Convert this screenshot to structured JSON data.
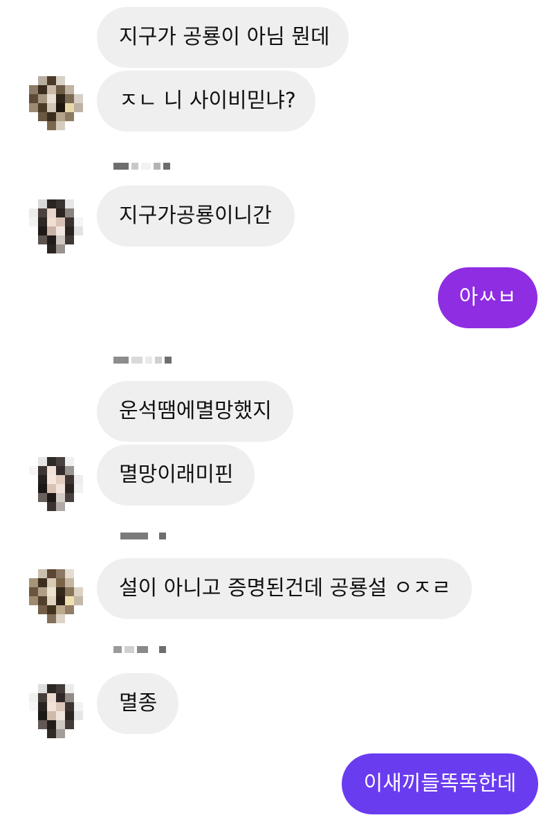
{
  "chat": {
    "messages": [
      {
        "direction": "in",
        "text": "지구가 공룡이 아님 뭔데"
      },
      {
        "direction": "in",
        "text": "ㅈㄴ 니 사이비믿냐?"
      },
      {
        "direction": "in",
        "text": "지구가공룡이니간"
      },
      {
        "direction": "out",
        "text": "아ㅆㅂ"
      },
      {
        "direction": "in",
        "text": "운석땜에멸망했지"
      },
      {
        "direction": "in",
        "text": "멸망이래미핀"
      },
      {
        "direction": "in",
        "text": "설이 아니고 증명된건데 공룡설 ㅇㅈㄹ"
      },
      {
        "direction": "in",
        "text": "멸종"
      },
      {
        "direction": "out",
        "text": "이새끼들똑똑한데"
      }
    ]
  },
  "colors": {
    "incoming_bubble": "#efefef",
    "incoming_text": "#111111",
    "outgoing_bubble_1": "#8e2de2",
    "outgoing_bubble_2": "#6a3cf0",
    "outgoing_text": "#ffffff"
  },
  "avatars": [
    {
      "name": "avatar-user-1",
      "icon": "pixelated-profile-photo"
    },
    {
      "name": "avatar-user-2",
      "icon": "pixelated-profile-photo"
    },
    {
      "name": "avatar-user-3",
      "icon": "pixelated-profile-photo"
    },
    {
      "name": "avatar-user-4",
      "icon": "pixelated-profile-photo"
    },
    {
      "name": "avatar-user-5",
      "icon": "pixelated-profile-photo"
    }
  ]
}
